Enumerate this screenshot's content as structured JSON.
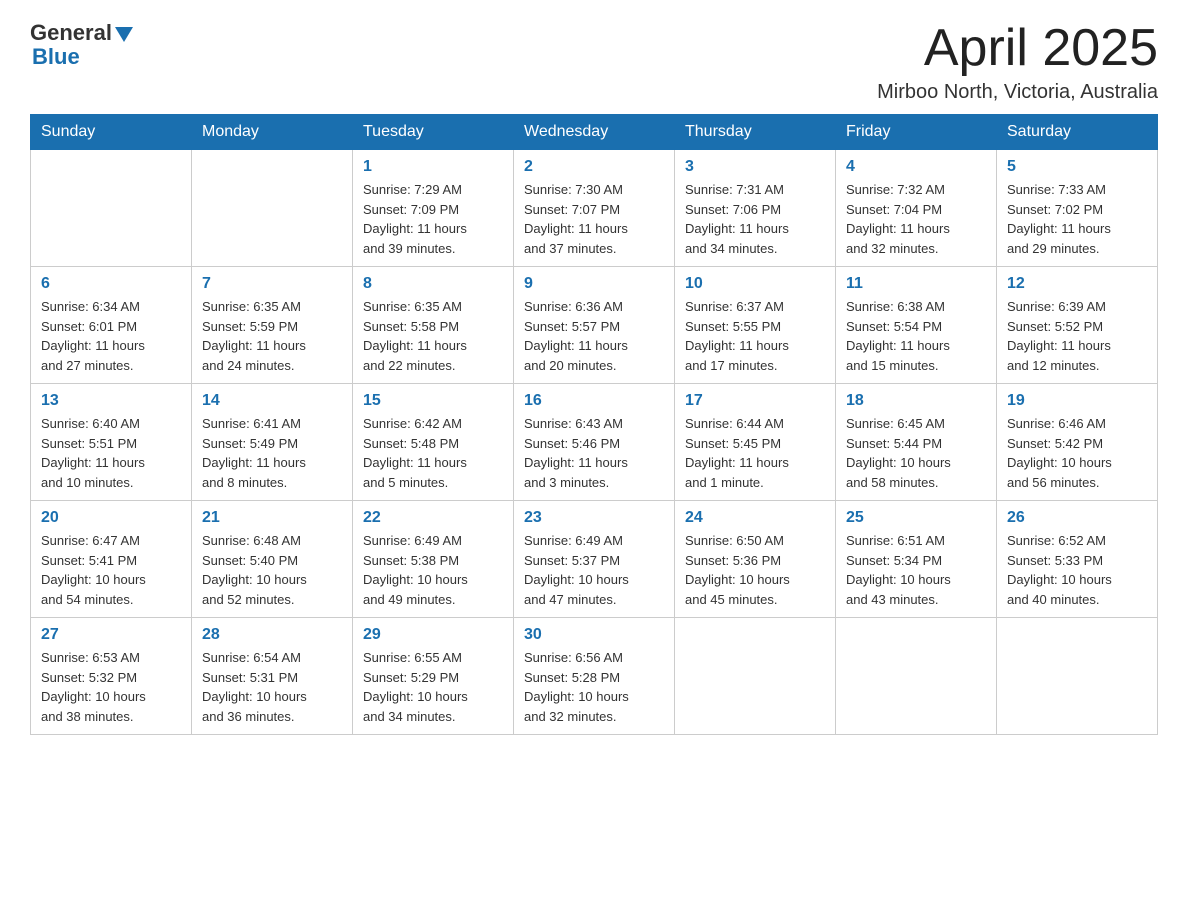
{
  "header": {
    "month_year": "April 2025",
    "location": "Mirboo North, Victoria, Australia",
    "logo_general": "General",
    "logo_blue": "Blue"
  },
  "weekdays": [
    "Sunday",
    "Monday",
    "Tuesday",
    "Wednesday",
    "Thursday",
    "Friday",
    "Saturday"
  ],
  "weeks": [
    [
      {
        "day": "",
        "detail": ""
      },
      {
        "day": "",
        "detail": ""
      },
      {
        "day": "1",
        "detail": "Sunrise: 7:29 AM\nSunset: 7:09 PM\nDaylight: 11 hours\nand 39 minutes."
      },
      {
        "day": "2",
        "detail": "Sunrise: 7:30 AM\nSunset: 7:07 PM\nDaylight: 11 hours\nand 37 minutes."
      },
      {
        "day": "3",
        "detail": "Sunrise: 7:31 AM\nSunset: 7:06 PM\nDaylight: 11 hours\nand 34 minutes."
      },
      {
        "day": "4",
        "detail": "Sunrise: 7:32 AM\nSunset: 7:04 PM\nDaylight: 11 hours\nand 32 minutes."
      },
      {
        "day": "5",
        "detail": "Sunrise: 7:33 AM\nSunset: 7:02 PM\nDaylight: 11 hours\nand 29 minutes."
      }
    ],
    [
      {
        "day": "6",
        "detail": "Sunrise: 6:34 AM\nSunset: 6:01 PM\nDaylight: 11 hours\nand 27 minutes."
      },
      {
        "day": "7",
        "detail": "Sunrise: 6:35 AM\nSunset: 5:59 PM\nDaylight: 11 hours\nand 24 minutes."
      },
      {
        "day": "8",
        "detail": "Sunrise: 6:35 AM\nSunset: 5:58 PM\nDaylight: 11 hours\nand 22 minutes."
      },
      {
        "day": "9",
        "detail": "Sunrise: 6:36 AM\nSunset: 5:57 PM\nDaylight: 11 hours\nand 20 minutes."
      },
      {
        "day": "10",
        "detail": "Sunrise: 6:37 AM\nSunset: 5:55 PM\nDaylight: 11 hours\nand 17 minutes."
      },
      {
        "day": "11",
        "detail": "Sunrise: 6:38 AM\nSunset: 5:54 PM\nDaylight: 11 hours\nand 15 minutes."
      },
      {
        "day": "12",
        "detail": "Sunrise: 6:39 AM\nSunset: 5:52 PM\nDaylight: 11 hours\nand 12 minutes."
      }
    ],
    [
      {
        "day": "13",
        "detail": "Sunrise: 6:40 AM\nSunset: 5:51 PM\nDaylight: 11 hours\nand 10 minutes."
      },
      {
        "day": "14",
        "detail": "Sunrise: 6:41 AM\nSunset: 5:49 PM\nDaylight: 11 hours\nand 8 minutes."
      },
      {
        "day": "15",
        "detail": "Sunrise: 6:42 AM\nSunset: 5:48 PM\nDaylight: 11 hours\nand 5 minutes."
      },
      {
        "day": "16",
        "detail": "Sunrise: 6:43 AM\nSunset: 5:46 PM\nDaylight: 11 hours\nand 3 minutes."
      },
      {
        "day": "17",
        "detail": "Sunrise: 6:44 AM\nSunset: 5:45 PM\nDaylight: 11 hours\nand 1 minute."
      },
      {
        "day": "18",
        "detail": "Sunrise: 6:45 AM\nSunset: 5:44 PM\nDaylight: 10 hours\nand 58 minutes."
      },
      {
        "day": "19",
        "detail": "Sunrise: 6:46 AM\nSunset: 5:42 PM\nDaylight: 10 hours\nand 56 minutes."
      }
    ],
    [
      {
        "day": "20",
        "detail": "Sunrise: 6:47 AM\nSunset: 5:41 PM\nDaylight: 10 hours\nand 54 minutes."
      },
      {
        "day": "21",
        "detail": "Sunrise: 6:48 AM\nSunset: 5:40 PM\nDaylight: 10 hours\nand 52 minutes."
      },
      {
        "day": "22",
        "detail": "Sunrise: 6:49 AM\nSunset: 5:38 PM\nDaylight: 10 hours\nand 49 minutes."
      },
      {
        "day": "23",
        "detail": "Sunrise: 6:49 AM\nSunset: 5:37 PM\nDaylight: 10 hours\nand 47 minutes."
      },
      {
        "day": "24",
        "detail": "Sunrise: 6:50 AM\nSunset: 5:36 PM\nDaylight: 10 hours\nand 45 minutes."
      },
      {
        "day": "25",
        "detail": "Sunrise: 6:51 AM\nSunset: 5:34 PM\nDaylight: 10 hours\nand 43 minutes."
      },
      {
        "day": "26",
        "detail": "Sunrise: 6:52 AM\nSunset: 5:33 PM\nDaylight: 10 hours\nand 40 minutes."
      }
    ],
    [
      {
        "day": "27",
        "detail": "Sunrise: 6:53 AM\nSunset: 5:32 PM\nDaylight: 10 hours\nand 38 minutes."
      },
      {
        "day": "28",
        "detail": "Sunrise: 6:54 AM\nSunset: 5:31 PM\nDaylight: 10 hours\nand 36 minutes."
      },
      {
        "day": "29",
        "detail": "Sunrise: 6:55 AM\nSunset: 5:29 PM\nDaylight: 10 hours\nand 34 minutes."
      },
      {
        "day": "30",
        "detail": "Sunrise: 6:56 AM\nSunset: 5:28 PM\nDaylight: 10 hours\nand 32 minutes."
      },
      {
        "day": "",
        "detail": ""
      },
      {
        "day": "",
        "detail": ""
      },
      {
        "day": "",
        "detail": ""
      }
    ]
  ]
}
